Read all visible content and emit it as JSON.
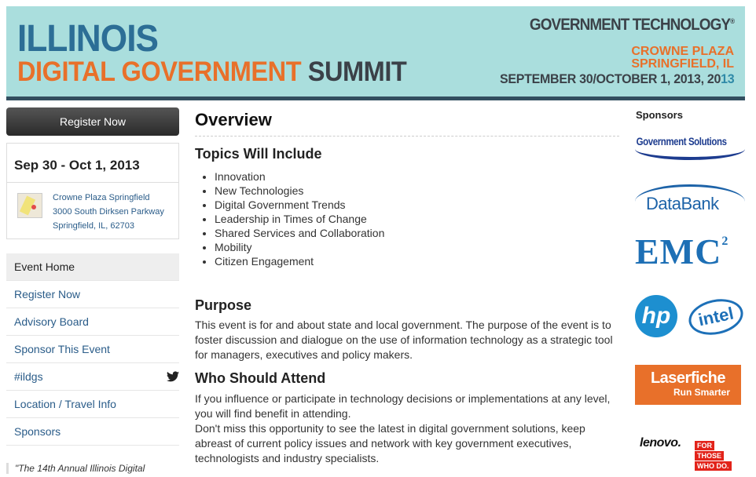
{
  "banner": {
    "line1": "ILLINOIS",
    "line2_a": "DIGITAL GOVERNMENT",
    "line2_b": "SUMMIT",
    "brand": "GOVERNMENT TECHNOLOGY",
    "brand_mark": "®",
    "venue1": "CROWNE PLAZA",
    "venue2": "SPRINGFIELD, IL",
    "dates_a": "SEPTEMBER 30/OCTOBER 1, 2013, 20",
    "dates_b": "13"
  },
  "sidebar": {
    "register_label": "Register Now",
    "date_range": "Sep 30 - Oct 1, 2013",
    "address": {
      "line1": "Crowne Plaza Springfield",
      "line2": "3000 South Dirksen Parkway",
      "line3": "Springfield, IL, 62703"
    },
    "nav": [
      {
        "label": "Event Home",
        "active": true
      },
      {
        "label": "Register Now"
      },
      {
        "label": "Advisory Board"
      },
      {
        "label": "Sponsor This Event"
      },
      {
        "label": "#ildgs",
        "icon": "twitter-icon"
      },
      {
        "label": "Location / Travel Info"
      },
      {
        "label": "Sponsors"
      }
    ],
    "quote": "\"The 14th Annual Illinois Digital"
  },
  "main": {
    "title": "Overview",
    "topics_heading": "Topics Will Include",
    "topics": [
      "Innovation",
      "New Technologies",
      "Digital Government Trends",
      "Leadership in Times of Change",
      "Shared Services and Collaboration",
      "Mobility",
      "Citizen Engagement"
    ],
    "purpose_heading": "Purpose",
    "purpose_text": "This event is for and about state and local government. The purpose of the event is to foster discussion and dialogue on the use of information technology as a strategic tool for managers, executives and policy makers.",
    "who_heading": "Who Should Attend",
    "who_text1": "If you influence or participate in technology decisions or implementations at any level, you will find benefit in attending.",
    "who_text2": "Don't miss this opportunity to see the latest in digital government solutions, keep abreast of current policy issues and network with key government executives, technologists and industry specialists."
  },
  "sponsors": {
    "heading": "Sponsors",
    "govsol": "Government Solutions",
    "databank": "DataBank",
    "emc": "EMC",
    "emc_sup": "2",
    "hp": "hp",
    "intel": "intel",
    "laserfiche_a": "Laserfiche",
    "laserfiche_b": "Run Smarter",
    "lenovo": "lenovo.",
    "lenovo_tag": [
      "FOR",
      "THOSE",
      "WHO DO."
    ]
  },
  "colors": {
    "banner_bg": "#aadedd",
    "accent_orange": "#e8702a",
    "accent_blue": "#2c6e96",
    "link_blue": "#2a5c89"
  }
}
